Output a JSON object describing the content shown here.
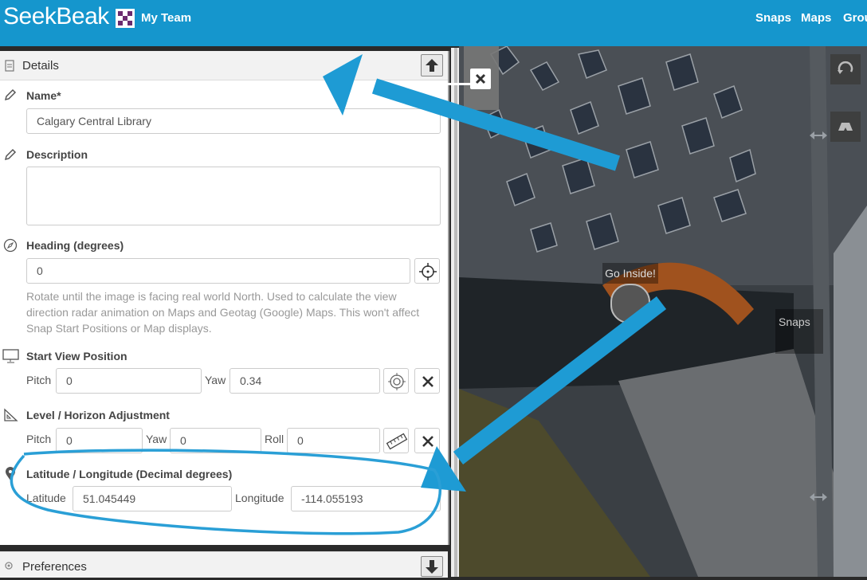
{
  "topbar": {
    "logo": "SeekBeak",
    "team": "My Team",
    "nav": [
      "Snaps",
      "Maps",
      "Grou"
    ]
  },
  "details": {
    "title": "Details",
    "name_label": "Name*",
    "name_value": "Calgary Central Library",
    "description_label": "Description",
    "description_value": "",
    "heading_label": "Heading (degrees)",
    "heading_value": "0",
    "heading_help": "Rotate until the image is facing real world North. Used to calculate the view direction radar animation on Maps and Geotag (Google) Maps. This won't affect Snap Start Positions or Map displays.",
    "start_view_label": "Start View Position",
    "pitch_label": "Pitch",
    "pitch_value": "0",
    "yaw_label": "Yaw",
    "yaw_value": "0.34",
    "level_label": "Level / Horizon Adjustment",
    "level_pitch_label": "Pitch",
    "level_pitch_value": "0",
    "level_yaw_label": "Yaw",
    "level_yaw_value": "0",
    "roll_label": "Roll",
    "roll_value": "0",
    "latlng_label": "Latitude / Longitude (Decimal degrees)",
    "latitude_label": "Latitude",
    "latitude_value": "51.045449",
    "longitude_label": "Longitude",
    "longitude_value": "-114.055193"
  },
  "preferences": {
    "title": "Preferences"
  },
  "viewer": {
    "go_inside": "Go Inside!",
    "snapshot_partial": "Snaps"
  },
  "colors": {
    "brand": "#1596cd",
    "arrow": "#1e9bd4"
  }
}
